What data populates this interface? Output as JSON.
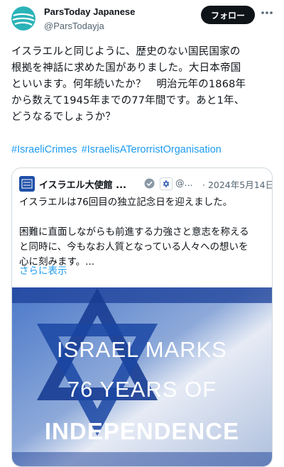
{
  "account": {
    "name": "ParsToday Japanese",
    "handle": "@ParsTodayja",
    "follow_label": "フォロー"
  },
  "tweet": {
    "text": "イスラエルと同じように、歴史のない国民国家の\n根拠を神話に求めた国がありました。大日本帝国\nといいます。何年続いたか？　明治元年の1868年\nから数えて1945年までの77年間です。あと1年、\nどうなるでしょうか？",
    "hashtags": [
      "#IsraeliCrimes",
      "#IsraelisATerorristOrganisation"
    ]
  },
  "quoted": {
    "name": "イスラエル大使館 ...",
    "handle": "@...",
    "date": "· 2024年5月14日",
    "text": "イスラエルは76回目の独立記念日を迎えました。\n\n困難に直面しながらも前進する力強さと意志を称える\nと同時に、今もなお人質となっている人々への想いを\n心に刻みます。...",
    "show_more": "さらに表示",
    "image_lines": [
      "ISRAEL MARKS",
      "76 YEARS OF",
      "INDEPENDENCE"
    ]
  },
  "colors": {
    "link": "#1d9bf0",
    "flag_blue": "#1e4fa8"
  }
}
